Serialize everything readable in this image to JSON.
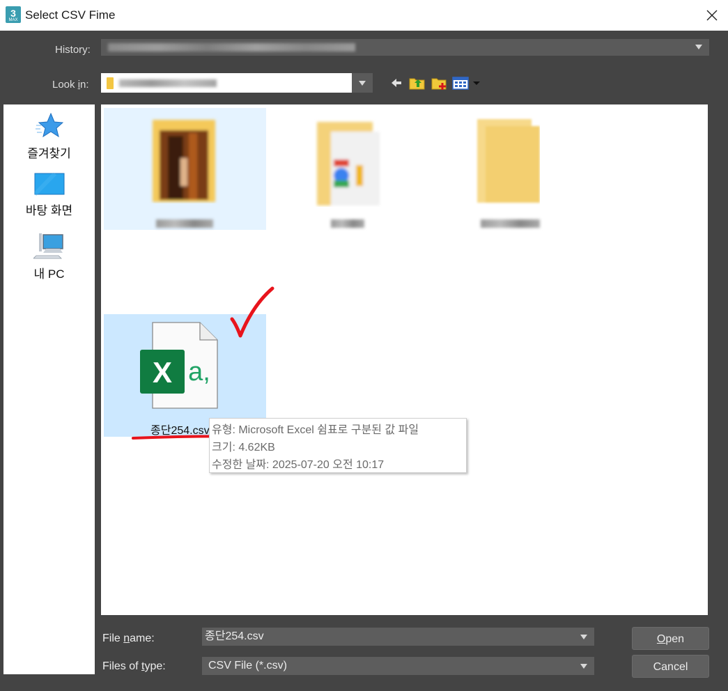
{
  "window": {
    "title": "Select CSV Fime",
    "app_icon_text": "3",
    "app_icon_sub": "MAX"
  },
  "history": {
    "label": "History:"
  },
  "lookin": {
    "label_pre": "Look ",
    "label_acc": "i",
    "label_post": "n:"
  },
  "sidebar": {
    "items": [
      {
        "label": "즐겨찾기",
        "icon": "star-icon"
      },
      {
        "label": "바탕 화면",
        "icon": "desktop-icon"
      },
      {
        "label": "내 PC",
        "icon": "computer-icon"
      }
    ]
  },
  "files": {
    "selected": {
      "name": "종단254.csv",
      "icon": "excel-csv-icon"
    }
  },
  "tooltip": {
    "type_line": "유형: Microsoft Excel 쉼표로 구분된 값 파일",
    "size_line": "크기: 4.62KB",
    "date_line": "수정한 날짜: 2025-07-20 오전 10:17"
  },
  "filename": {
    "label_pre": "File ",
    "label_acc": "n",
    "label_post": "ame:",
    "value": "종단254.csv"
  },
  "filetype": {
    "label_pre": "Files of ",
    "label_acc": "t",
    "label_post": "ype:",
    "value": "CSV File (*.csv)"
  },
  "buttons": {
    "open_acc": "O",
    "open_rest": "pen",
    "cancel": "Cancel"
  },
  "colors": {
    "accent_red": "#e8141c",
    "selection": "#cce8ff",
    "excel_green": "#107c41"
  }
}
